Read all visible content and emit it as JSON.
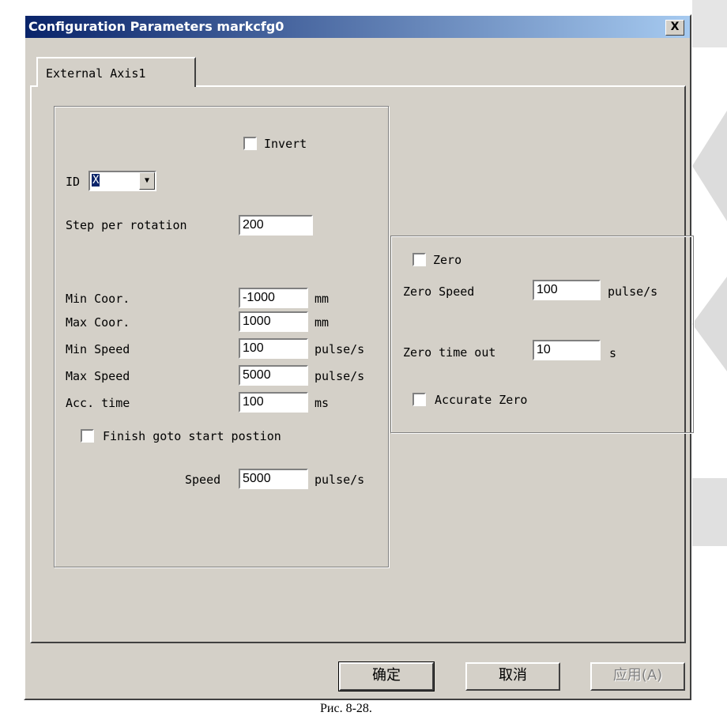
{
  "dialog": {
    "title": "Configuration Parameters markcfg0",
    "close_label": "X"
  },
  "tabs": [
    {
      "label": "External Axis1"
    }
  ],
  "left": {
    "invert_label": "Invert",
    "id_label": "ID",
    "id_value": "X",
    "step_label": "Step per rotation",
    "step_value": "200",
    "rows": [
      {
        "label": "Min Coor.",
        "value": "-1000",
        "unit": "mm"
      },
      {
        "label": "Max Coor.",
        "value": "1000",
        "unit": "mm"
      },
      {
        "label": "Min Speed",
        "value": "100",
        "unit": "pulse/s"
      },
      {
        "label": "Max Speed",
        "value": "5000",
        "unit": "pulse/s"
      },
      {
        "label": "Acc. time",
        "value": "100",
        "unit": "ms"
      }
    ],
    "finish_label": "Finish goto start postion",
    "speed_label": "Speed",
    "speed_value": "5000",
    "speed_unit": "pulse/s"
  },
  "right": {
    "zero_label": "Zero",
    "zero_speed_label": "Zero Speed",
    "zero_speed_value": "100",
    "zero_speed_unit": "pulse/s",
    "zero_timeout_label": "Zero time out",
    "zero_timeout_value": "10",
    "zero_timeout_unit": "s",
    "accurate_zero_label": "Accurate Zero"
  },
  "buttons": {
    "ok": "确定",
    "cancel": "取消",
    "apply": "应用(A)"
  },
  "page": {
    "caption": "Рис. 8-28."
  }
}
